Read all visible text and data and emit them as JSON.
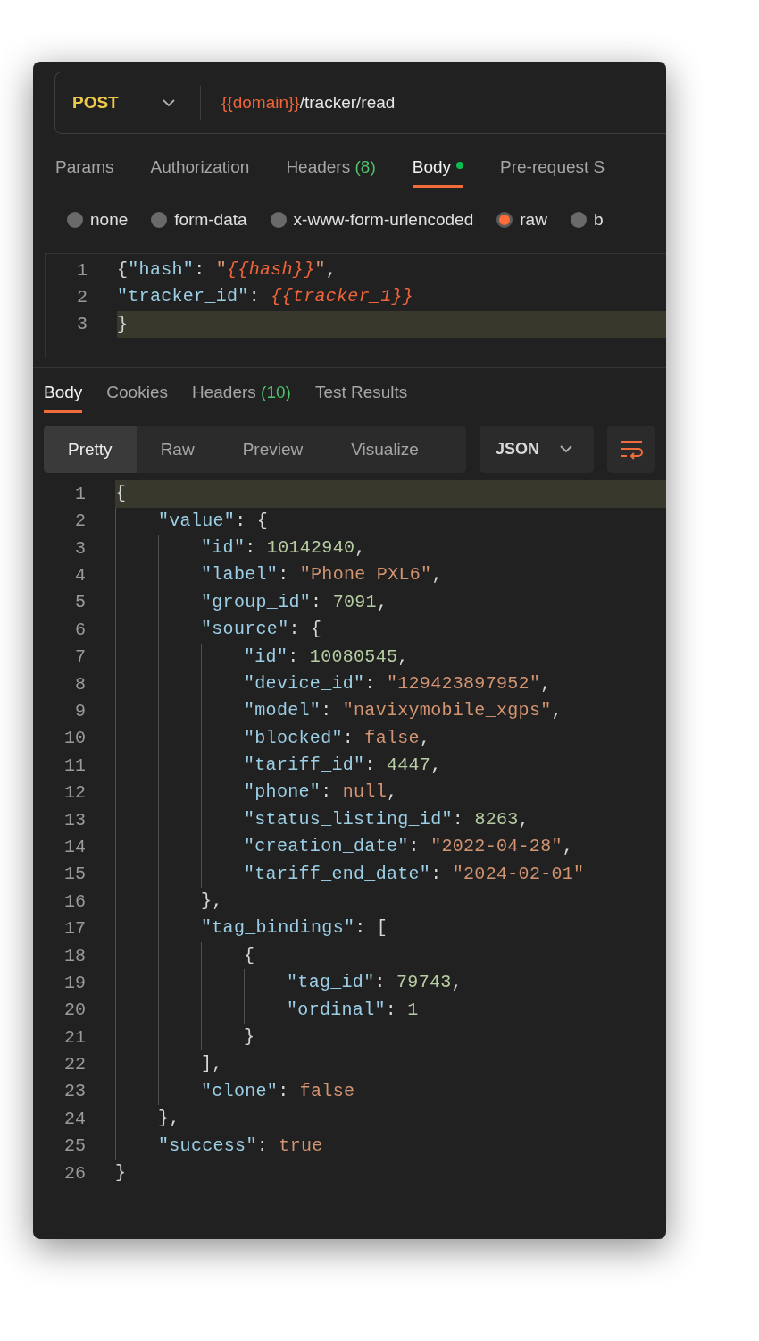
{
  "request": {
    "method": "POST",
    "url": [
      {
        "kind": "variable",
        "text": "{{domain}}"
      },
      {
        "kind": "plain",
        "text": "/tracker/read"
      }
    ]
  },
  "request_tabs": [
    {
      "label": "Params",
      "selected": false,
      "indicator": false
    },
    {
      "label": "Authorization",
      "selected": false,
      "indicator": false
    },
    {
      "label": "Headers",
      "count": "(8)",
      "selected": false,
      "indicator": false
    },
    {
      "label": "Body",
      "selected": true,
      "indicator": true
    },
    {
      "label": "Pre-request S",
      "selected": false,
      "indicator": false
    }
  ],
  "body_types": [
    {
      "label": "none",
      "selected": false
    },
    {
      "label": "form-data",
      "selected": false
    },
    {
      "label": "x-www-form-urlencoded",
      "selected": false
    },
    {
      "label": "raw",
      "selected": true
    },
    {
      "label": "b",
      "selected": false
    }
  ],
  "request_body": [
    {
      "number": "1",
      "active": false,
      "tokens": [
        {
          "kind": "punct",
          "text": "{"
        },
        {
          "kind": "key",
          "text": "\"hash\""
        },
        {
          "kind": "punct",
          "text": ": "
        },
        {
          "kind": "string",
          "text": "\""
        },
        {
          "kind": "variable",
          "text": "{{hash}}"
        },
        {
          "kind": "string",
          "text": "\""
        },
        {
          "kind": "punct",
          "text": ","
        }
      ]
    },
    {
      "number": "2",
      "active": false,
      "tokens": [
        {
          "kind": "key",
          "text": "\"tracker_id\""
        },
        {
          "kind": "punct",
          "text": ": "
        },
        {
          "kind": "variable",
          "text": "{{tracker_1}}"
        }
      ]
    },
    {
      "number": "3",
      "active": true,
      "tokens": [
        {
          "kind": "punct",
          "text": "}"
        }
      ]
    }
  ],
  "response_tabs": [
    {
      "label": "Body",
      "selected": true
    },
    {
      "label": "Cookies",
      "selected": false
    },
    {
      "label": "Headers",
      "count": "(10)",
      "selected": false
    },
    {
      "label": "Test Results",
      "selected": false
    }
  ],
  "view_modes": [
    {
      "label": "Pretty",
      "selected": true
    },
    {
      "label": "Raw",
      "selected": false
    },
    {
      "label": "Preview",
      "selected": false
    },
    {
      "label": "Visualize",
      "selected": false
    }
  ],
  "format": "JSON",
  "response_body": [
    {
      "number": "1",
      "active": true,
      "tokens": [
        {
          "kind": "punct",
          "text": "{"
        }
      ],
      "children": [
        {
          "number": "2",
          "active": false,
          "tokens": [
            {
              "kind": "key",
              "text": "\"value\""
            },
            {
              "kind": "punct",
              "text": ": {"
            }
          ],
          "children": [
            {
              "number": "3",
              "active": false,
              "tokens": [
                {
                  "kind": "key",
                  "text": "\"id\""
                },
                {
                  "kind": "punct",
                  "text": ": "
                },
                {
                  "kind": "number",
                  "text": "10142940"
                },
                {
                  "kind": "punct",
                  "text": ","
                }
              ]
            },
            {
              "number": "4",
              "active": false,
              "tokens": [
                {
                  "kind": "key",
                  "text": "\"label\""
                },
                {
                  "kind": "punct",
                  "text": ": "
                },
                {
                  "kind": "string",
                  "text": "\"Phone PXL6\""
                },
                {
                  "kind": "punct",
                  "text": ","
                }
              ]
            },
            {
              "number": "5",
              "active": false,
              "tokens": [
                {
                  "kind": "key",
                  "text": "\"group_id\""
                },
                {
                  "kind": "punct",
                  "text": ": "
                },
                {
                  "kind": "number",
                  "text": "7091"
                },
                {
                  "kind": "punct",
                  "text": ","
                }
              ]
            },
            {
              "number": "6",
              "active": false,
              "tokens": [
                {
                  "kind": "key",
                  "text": "\"source\""
                },
                {
                  "kind": "punct",
                  "text": ": {"
                }
              ],
              "children": [
                {
                  "number": "7",
                  "active": false,
                  "tokens": [
                    {
                      "kind": "key",
                      "text": "\"id\""
                    },
                    {
                      "kind": "punct",
                      "text": ": "
                    },
                    {
                      "kind": "number",
                      "text": "10080545"
                    },
                    {
                      "kind": "punct",
                      "text": ","
                    }
                  ]
                },
                {
                  "number": "8",
                  "active": false,
                  "tokens": [
                    {
                      "kind": "key",
                      "text": "\"device_id\""
                    },
                    {
                      "kind": "punct",
                      "text": ": "
                    },
                    {
                      "kind": "string",
                      "text": "\"129423897952\""
                    },
                    {
                      "kind": "punct",
                      "text": ","
                    }
                  ]
                },
                {
                  "number": "9",
                  "active": false,
                  "tokens": [
                    {
                      "kind": "key",
                      "text": "\"model\""
                    },
                    {
                      "kind": "punct",
                      "text": ": "
                    },
                    {
                      "kind": "string",
                      "text": "\"navixymobile_xgps\""
                    },
                    {
                      "kind": "punct",
                      "text": ","
                    }
                  ]
                },
                {
                  "number": "10",
                  "active": false,
                  "tokens": [
                    {
                      "kind": "key",
                      "text": "\"blocked\""
                    },
                    {
                      "kind": "punct",
                      "text": ": "
                    },
                    {
                      "kind": "literal",
                      "text": "false"
                    },
                    {
                      "kind": "punct",
                      "text": ","
                    }
                  ]
                },
                {
                  "number": "11",
                  "active": false,
                  "tokens": [
                    {
                      "kind": "key",
                      "text": "\"tariff_id\""
                    },
                    {
                      "kind": "punct",
                      "text": ": "
                    },
                    {
                      "kind": "number",
                      "text": "4447"
                    },
                    {
                      "kind": "punct",
                      "text": ","
                    }
                  ]
                },
                {
                  "number": "12",
                  "active": false,
                  "tokens": [
                    {
                      "kind": "key",
                      "text": "\"phone\""
                    },
                    {
                      "kind": "punct",
                      "text": ": "
                    },
                    {
                      "kind": "literal",
                      "text": "null"
                    },
                    {
                      "kind": "punct",
                      "text": ","
                    }
                  ]
                },
                {
                  "number": "13",
                  "active": false,
                  "tokens": [
                    {
                      "kind": "key",
                      "text": "\"status_listing_id\""
                    },
                    {
                      "kind": "punct",
                      "text": ": "
                    },
                    {
                      "kind": "number",
                      "text": "8263"
                    },
                    {
                      "kind": "punct",
                      "text": ","
                    }
                  ]
                },
                {
                  "number": "14",
                  "active": false,
                  "tokens": [
                    {
                      "kind": "key",
                      "text": "\"creation_date\""
                    },
                    {
                      "kind": "punct",
                      "text": ": "
                    },
                    {
                      "kind": "string",
                      "text": "\"2022-04-28\""
                    },
                    {
                      "kind": "punct",
                      "text": ","
                    }
                  ]
                },
                {
                  "number": "15",
                  "active": false,
                  "tokens": [
                    {
                      "kind": "key",
                      "text": "\"tariff_end_date\""
                    },
                    {
                      "kind": "punct",
                      "text": ": "
                    },
                    {
                      "kind": "string",
                      "text": "\"2024-02-01\""
                    }
                  ]
                }
              ]
            },
            {
              "number": "16",
              "active": false,
              "tokens": [
                {
                  "kind": "punct",
                  "text": "},"
                }
              ]
            },
            {
              "number": "17",
              "active": false,
              "tokens": [
                {
                  "kind": "key",
                  "text": "\"tag_bindings\""
                },
                {
                  "kind": "punct",
                  "text": ": ["
                }
              ],
              "children": [
                {
                  "number": "18",
                  "active": false,
                  "tokens": [
                    {
                      "kind": "punct",
                      "text": "{"
                    }
                  ],
                  "children": [
                    {
                      "number": "19",
                      "active": false,
                      "tokens": [
                        {
                          "kind": "key",
                          "text": "\"tag_id\""
                        },
                        {
                          "kind": "punct",
                          "text": ": "
                        },
                        {
                          "kind": "number",
                          "text": "79743"
                        },
                        {
                          "kind": "punct",
                          "text": ","
                        }
                      ]
                    },
                    {
                      "number": "20",
                      "active": false,
                      "tokens": [
                        {
                          "kind": "key",
                          "text": "\"ordinal\""
                        },
                        {
                          "kind": "punct",
                          "text": ": "
                        },
                        {
                          "kind": "number",
                          "text": "1"
                        }
                      ]
                    }
                  ]
                },
                {
                  "number": "21",
                  "active": false,
                  "tokens": [
                    {
                      "kind": "punct",
                      "text": "}"
                    }
                  ]
                }
              ]
            },
            {
              "number": "22",
              "active": false,
              "tokens": [
                {
                  "kind": "punct",
                  "text": "],"
                }
              ]
            },
            {
              "number": "23",
              "active": false,
              "tokens": [
                {
                  "kind": "key",
                  "text": "\"clone\""
                },
                {
                  "kind": "punct",
                  "text": ": "
                },
                {
                  "kind": "literal",
                  "text": "false"
                }
              ]
            }
          ]
        },
        {
          "number": "24",
          "active": false,
          "tokens": [
            {
              "kind": "punct",
              "text": "},"
            }
          ]
        },
        {
          "number": "25",
          "active": false,
          "tokens": [
            {
              "kind": "key",
              "text": "\"success\""
            },
            {
              "kind": "punct",
              "text": ": "
            },
            {
              "kind": "literal",
              "text": "true"
            }
          ]
        }
      ]
    },
    {
      "number": "26",
      "active": false,
      "tokens": [
        {
          "kind": "punct",
          "text": "}"
        }
      ]
    }
  ]
}
